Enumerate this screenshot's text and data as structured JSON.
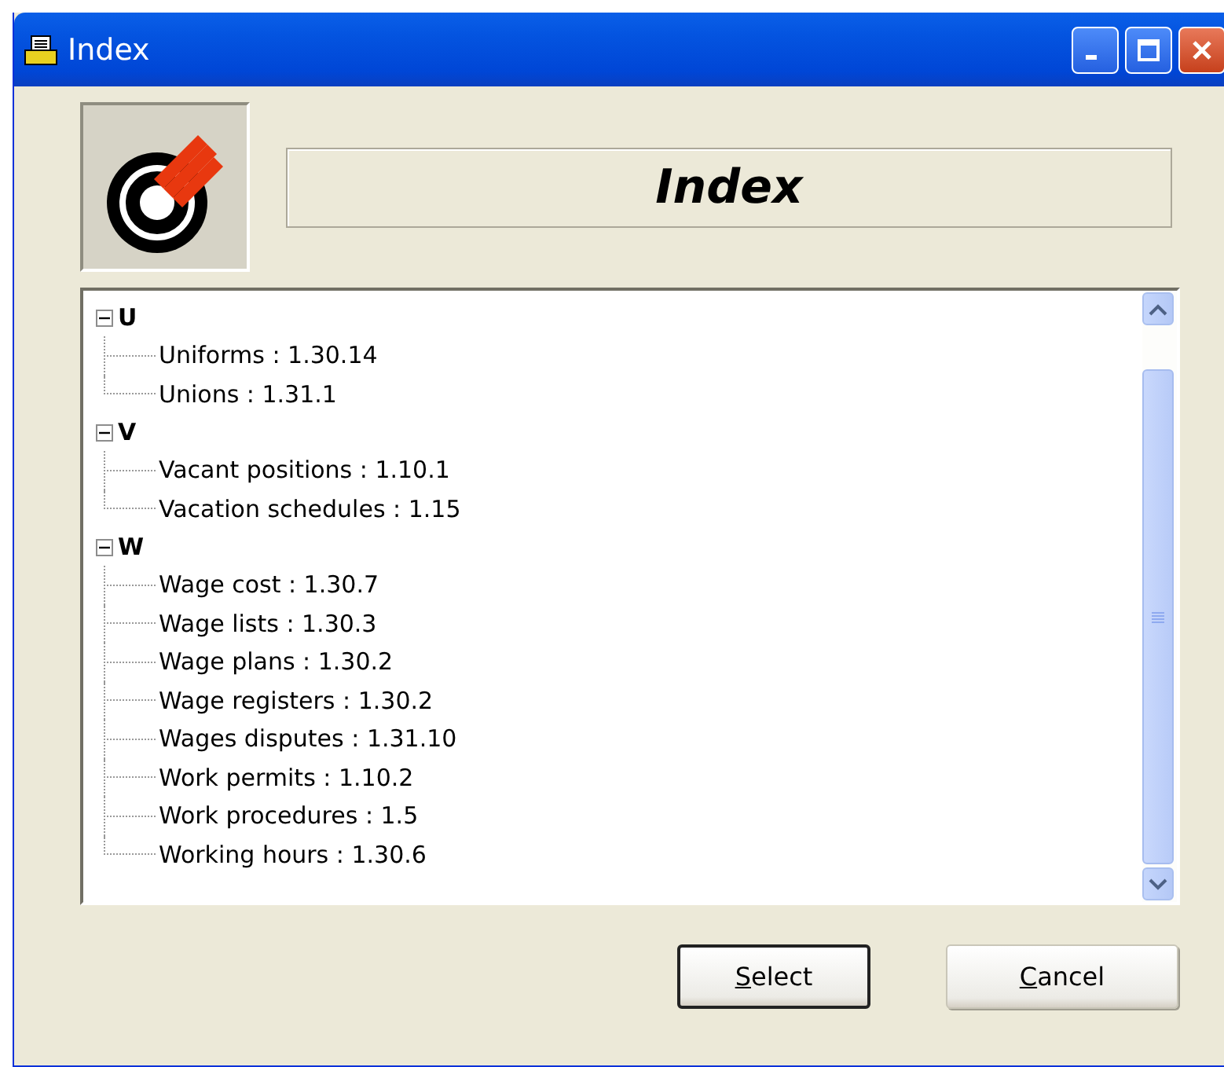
{
  "window": {
    "title": "Index"
  },
  "header": {
    "title": "Index"
  },
  "tree": [
    {
      "label": "U",
      "expanded": true,
      "children": [
        {
          "label": "Uniforms : 1.30.14"
        },
        {
          "label": "Unions : 1.31.1"
        }
      ]
    },
    {
      "label": "V",
      "expanded": true,
      "children": [
        {
          "label": "Vacant positions : 1.10.1"
        },
        {
          "label": "Vacation schedules : 1.15"
        }
      ]
    },
    {
      "label": "W",
      "expanded": true,
      "children": [
        {
          "label": "Wage cost : 1.30.7"
        },
        {
          "label": "Wage lists : 1.30.3"
        },
        {
          "label": "Wage plans : 1.30.2"
        },
        {
          "label": "Wage registers : 1.30.2"
        },
        {
          "label": "Wages disputes : 1.31.10"
        },
        {
          "label": "Work permits : 1.10.2"
        },
        {
          "label": "Work procedures : 1.5"
        },
        {
          "label": "Working hours : 1.30.6"
        }
      ]
    }
  ],
  "buttons": [
    {
      "label": "Select",
      "default": true
    },
    {
      "label": "Cancel",
      "default": false
    }
  ]
}
